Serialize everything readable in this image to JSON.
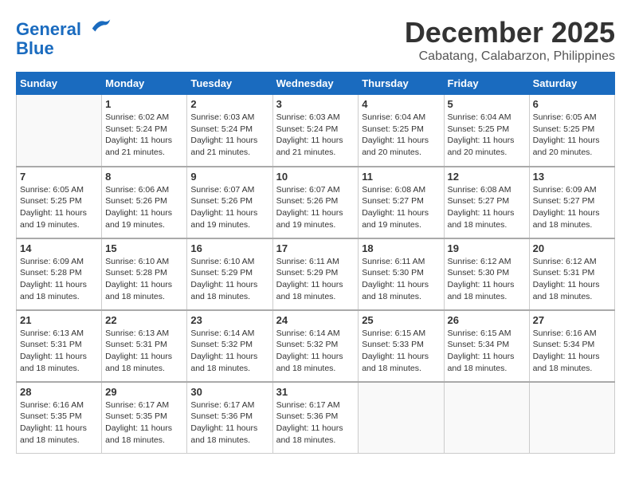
{
  "header": {
    "logo_line1": "General",
    "logo_line2": "Blue",
    "month": "December 2025",
    "location": "Cabatang, Calabarzon, Philippines"
  },
  "days_of_week": [
    "Sunday",
    "Monday",
    "Tuesday",
    "Wednesday",
    "Thursday",
    "Friday",
    "Saturday"
  ],
  "weeks": [
    [
      {
        "day": "",
        "info": ""
      },
      {
        "day": "1",
        "info": "Sunrise: 6:02 AM\nSunset: 5:24 PM\nDaylight: 11 hours\nand 21 minutes."
      },
      {
        "day": "2",
        "info": "Sunrise: 6:03 AM\nSunset: 5:24 PM\nDaylight: 11 hours\nand 21 minutes."
      },
      {
        "day": "3",
        "info": "Sunrise: 6:03 AM\nSunset: 5:24 PM\nDaylight: 11 hours\nand 21 minutes."
      },
      {
        "day": "4",
        "info": "Sunrise: 6:04 AM\nSunset: 5:25 PM\nDaylight: 11 hours\nand 20 minutes."
      },
      {
        "day": "5",
        "info": "Sunrise: 6:04 AM\nSunset: 5:25 PM\nDaylight: 11 hours\nand 20 minutes."
      },
      {
        "day": "6",
        "info": "Sunrise: 6:05 AM\nSunset: 5:25 PM\nDaylight: 11 hours\nand 20 minutes."
      }
    ],
    [
      {
        "day": "7",
        "info": "Sunrise: 6:05 AM\nSunset: 5:25 PM\nDaylight: 11 hours\nand 19 minutes."
      },
      {
        "day": "8",
        "info": "Sunrise: 6:06 AM\nSunset: 5:26 PM\nDaylight: 11 hours\nand 19 minutes."
      },
      {
        "day": "9",
        "info": "Sunrise: 6:07 AM\nSunset: 5:26 PM\nDaylight: 11 hours\nand 19 minutes."
      },
      {
        "day": "10",
        "info": "Sunrise: 6:07 AM\nSunset: 5:26 PM\nDaylight: 11 hours\nand 19 minutes."
      },
      {
        "day": "11",
        "info": "Sunrise: 6:08 AM\nSunset: 5:27 PM\nDaylight: 11 hours\nand 19 minutes."
      },
      {
        "day": "12",
        "info": "Sunrise: 6:08 AM\nSunset: 5:27 PM\nDaylight: 11 hours\nand 18 minutes."
      },
      {
        "day": "13",
        "info": "Sunrise: 6:09 AM\nSunset: 5:27 PM\nDaylight: 11 hours\nand 18 minutes."
      }
    ],
    [
      {
        "day": "14",
        "info": "Sunrise: 6:09 AM\nSunset: 5:28 PM\nDaylight: 11 hours\nand 18 minutes."
      },
      {
        "day": "15",
        "info": "Sunrise: 6:10 AM\nSunset: 5:28 PM\nDaylight: 11 hours\nand 18 minutes."
      },
      {
        "day": "16",
        "info": "Sunrise: 6:10 AM\nSunset: 5:29 PM\nDaylight: 11 hours\nand 18 minutes."
      },
      {
        "day": "17",
        "info": "Sunrise: 6:11 AM\nSunset: 5:29 PM\nDaylight: 11 hours\nand 18 minutes."
      },
      {
        "day": "18",
        "info": "Sunrise: 6:11 AM\nSunset: 5:30 PM\nDaylight: 11 hours\nand 18 minutes."
      },
      {
        "day": "19",
        "info": "Sunrise: 6:12 AM\nSunset: 5:30 PM\nDaylight: 11 hours\nand 18 minutes."
      },
      {
        "day": "20",
        "info": "Sunrise: 6:12 AM\nSunset: 5:31 PM\nDaylight: 11 hours\nand 18 minutes."
      }
    ],
    [
      {
        "day": "21",
        "info": "Sunrise: 6:13 AM\nSunset: 5:31 PM\nDaylight: 11 hours\nand 18 minutes."
      },
      {
        "day": "22",
        "info": "Sunrise: 6:13 AM\nSunset: 5:31 PM\nDaylight: 11 hours\nand 18 minutes."
      },
      {
        "day": "23",
        "info": "Sunrise: 6:14 AM\nSunset: 5:32 PM\nDaylight: 11 hours\nand 18 minutes."
      },
      {
        "day": "24",
        "info": "Sunrise: 6:14 AM\nSunset: 5:32 PM\nDaylight: 11 hours\nand 18 minutes."
      },
      {
        "day": "25",
        "info": "Sunrise: 6:15 AM\nSunset: 5:33 PM\nDaylight: 11 hours\nand 18 minutes."
      },
      {
        "day": "26",
        "info": "Sunrise: 6:15 AM\nSunset: 5:34 PM\nDaylight: 11 hours\nand 18 minutes."
      },
      {
        "day": "27",
        "info": "Sunrise: 6:16 AM\nSunset: 5:34 PM\nDaylight: 11 hours\nand 18 minutes."
      }
    ],
    [
      {
        "day": "28",
        "info": "Sunrise: 6:16 AM\nSunset: 5:35 PM\nDaylight: 11 hours\nand 18 minutes."
      },
      {
        "day": "29",
        "info": "Sunrise: 6:17 AM\nSunset: 5:35 PM\nDaylight: 11 hours\nand 18 minutes."
      },
      {
        "day": "30",
        "info": "Sunrise: 6:17 AM\nSunset: 5:36 PM\nDaylight: 11 hours\nand 18 minutes."
      },
      {
        "day": "31",
        "info": "Sunrise: 6:17 AM\nSunset: 5:36 PM\nDaylight: 11 hours\nand 18 minutes."
      },
      {
        "day": "",
        "info": ""
      },
      {
        "day": "",
        "info": ""
      },
      {
        "day": "",
        "info": ""
      }
    ]
  ]
}
